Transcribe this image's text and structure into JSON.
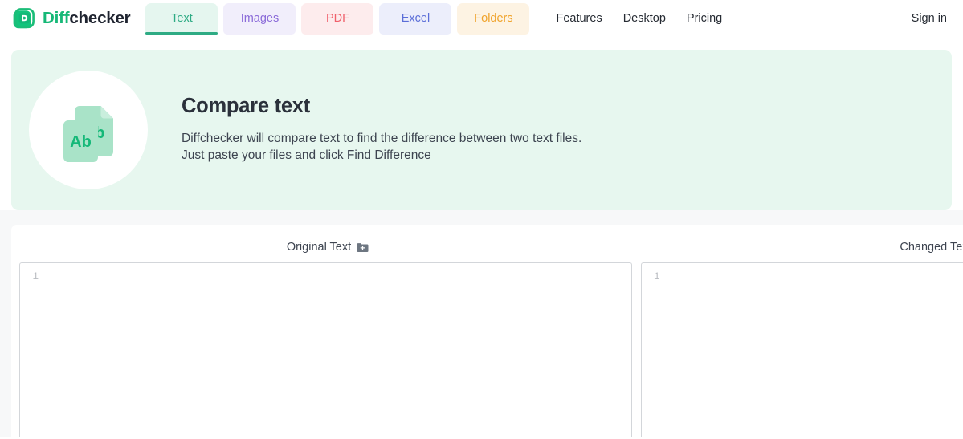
{
  "header": {
    "brand": {
      "prefix": "Diff",
      "suffix": "checker",
      "logo_icon": "diffchecker-d-logo-icon"
    },
    "tabs": [
      {
        "label": "Text",
        "active": true,
        "color": "#2eab84",
        "bg": "#e5f6ef"
      },
      {
        "label": "Images",
        "active": false,
        "color": "#8b6bd9",
        "bg": "#f1eefb"
      },
      {
        "label": "PDF",
        "active": false,
        "color": "#f0606b",
        "bg": "#fdeced"
      },
      {
        "label": "Excel",
        "active": false,
        "color": "#5b6ed8",
        "bg": "#eceefb"
      },
      {
        "label": "Folders",
        "active": false,
        "color": "#f0a32b",
        "bg": "#fdf3e3"
      }
    ],
    "nav_links": [
      "Features",
      "Desktop",
      "Pricing"
    ],
    "sign_in": "Sign in"
  },
  "hero": {
    "icon_name": "two-documents-ab-icon",
    "doc_label": "Ab",
    "title": "Compare text",
    "subtitle_line1": "Diffchecker will compare text to find the difference between two text files.",
    "subtitle_line2": "Just paste your files and click Find Difference",
    "background": "#e7f7ef"
  },
  "compare": {
    "panes": [
      {
        "label": "Original Text",
        "upload_icon": "file-add-icon",
        "line_number": "1",
        "value": "",
        "placeholder": ""
      },
      {
        "label": "Changed Text",
        "upload_icon": "file-add-icon",
        "line_number": "1",
        "value": "",
        "placeholder": ""
      }
    ]
  }
}
